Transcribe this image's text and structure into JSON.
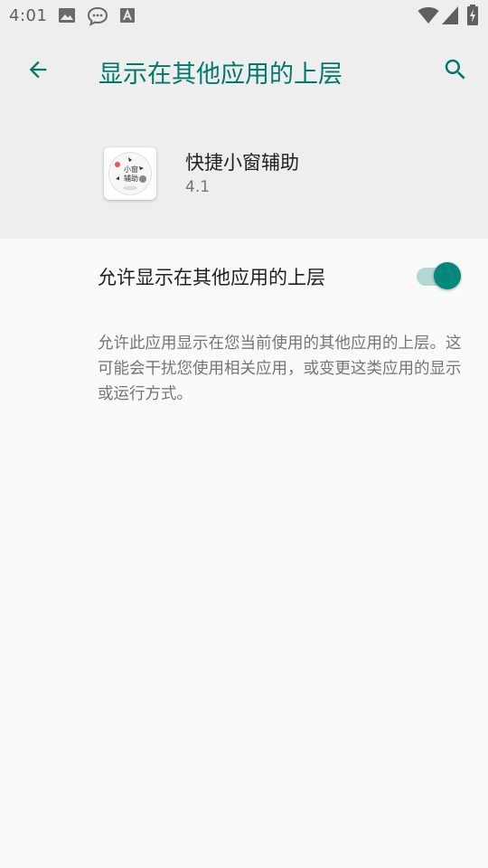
{
  "status_bar": {
    "time": "4:01",
    "icons": [
      "image-icon",
      "message-icon",
      "a-icon",
      "wifi-icon",
      "signal-icon",
      "battery-charging-icon"
    ]
  },
  "app_bar": {
    "back_icon": "arrow-back-icon",
    "title": "显示在其他应用的上层",
    "search_icon": "search-icon"
  },
  "app_info": {
    "icon_text": "小窗\n辅助",
    "name": "快捷小窗辅助",
    "version": "4.1"
  },
  "permission": {
    "label": "允许显示在其他应用的上层",
    "enabled": true,
    "description": "允许此应用显示在您当前使用的其他应用的上层。这可能会干扰您使用相关应用，或变更这类应用的显示或运行方式。"
  },
  "colors": {
    "accent": "#00796b",
    "switch_thumb": "#00897b",
    "switch_track": "#b2d8d3",
    "header_bg": "#eeeeee",
    "body_bg": "#fafafa"
  }
}
